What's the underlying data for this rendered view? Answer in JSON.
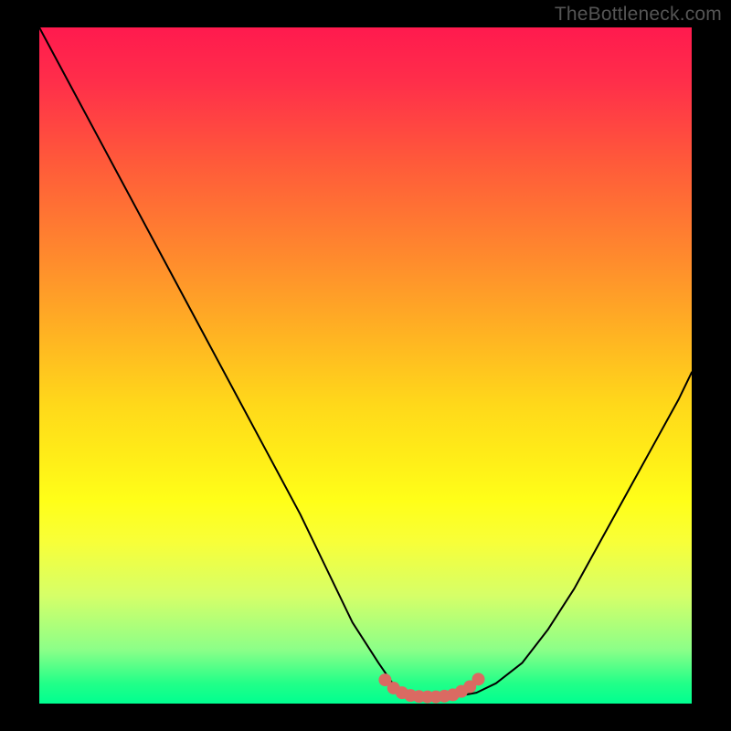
{
  "watermark": "TheBottleneck.com",
  "chart_data": {
    "type": "line",
    "title": "",
    "xlabel": "",
    "ylabel": "",
    "xlim": [
      0,
      100
    ],
    "ylim": [
      0,
      100
    ],
    "background_gradient": {
      "direction": "vertical",
      "stops": [
        {
          "pos": 0,
          "color": "#ff1a4e"
        },
        {
          "pos": 20,
          "color": "#ff5a3a"
        },
        {
          "pos": 46,
          "color": "#ffb522"
        },
        {
          "pos": 70,
          "color": "#ffff18"
        },
        {
          "pos": 92,
          "color": "#8cff88"
        },
        {
          "pos": 100,
          "color": "#00ff90"
        }
      ]
    },
    "series": [
      {
        "name": "bottleneck-curve",
        "color": "#000000",
        "x": [
          0,
          5,
          10,
          15,
          20,
          25,
          30,
          35,
          40,
          44,
          48,
          52,
          54,
          56,
          58,
          61,
          64,
          67,
          70,
          74,
          78,
          82,
          86,
          90,
          94,
          98,
          100
        ],
        "y": [
          100,
          91,
          82,
          73,
          64,
          55,
          46,
          37,
          28,
          20,
          12,
          6,
          3.2,
          1.8,
          1.2,
          1.0,
          1.1,
          1.6,
          3.0,
          6,
          11,
          17,
          24,
          31,
          38,
          45,
          49
        ]
      }
    ],
    "highlight": {
      "name": "valley-markers",
      "color": "#da6a62",
      "marker_radius_px": 7,
      "x": [
        53.0,
        54.3,
        55.6,
        56.9,
        58.2,
        59.5,
        60.8,
        62.1,
        63.4,
        64.7,
        66.0,
        67.3
      ],
      "y": [
        3.5,
        2.3,
        1.6,
        1.2,
        1.05,
        1.0,
        1.0,
        1.1,
        1.3,
        1.8,
        2.5,
        3.6
      ]
    }
  }
}
